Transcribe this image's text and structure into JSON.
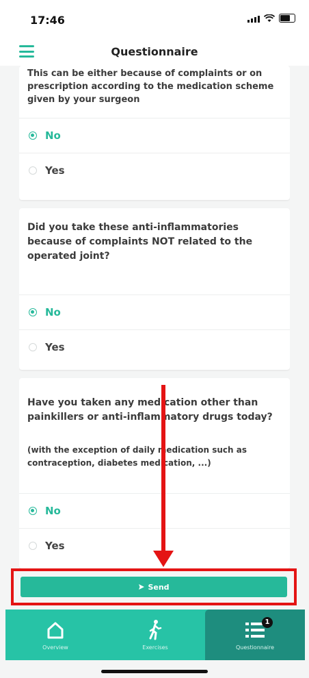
{
  "status_bar": {
    "time": "17:46"
  },
  "header": {
    "title": "Questionnaire"
  },
  "questions": [
    {
      "text": "This can be either because of complaints or on prescription according to the medication scheme given by your surgeon",
      "options": [
        {
          "label": "No",
          "selected": true
        },
        {
          "label": "Yes",
          "selected": false
        }
      ]
    },
    {
      "text": "Did you take these anti-inflammatories because of complaints NOT related to the operated joint?",
      "options": [
        {
          "label": "No",
          "selected": true
        },
        {
          "label": "Yes",
          "selected": false
        }
      ]
    },
    {
      "text": "Have you taken any medication other than painkillers or anti-inflammatory drugs today?",
      "note": "(with the exception of daily medication such as contraception, diabetes medication, ...)",
      "options": [
        {
          "label": "No",
          "selected": true
        },
        {
          "label": "Yes",
          "selected": false
        }
      ]
    }
  ],
  "send_button": {
    "label": "Send",
    "icon": "send-icon"
  },
  "bottom_nav": [
    {
      "label": "Overview",
      "icon": "home-icon",
      "active": false
    },
    {
      "label": "Exercises",
      "icon": "walking-icon",
      "active": false
    },
    {
      "label": "Questionnaire",
      "icon": "list-icon",
      "active": true,
      "badge": "1"
    }
  ],
  "colors": {
    "accent": "#26b99a",
    "nav_bg": "#27c3a6",
    "nav_active": "#1e8d7e",
    "highlight": "#e41414"
  }
}
